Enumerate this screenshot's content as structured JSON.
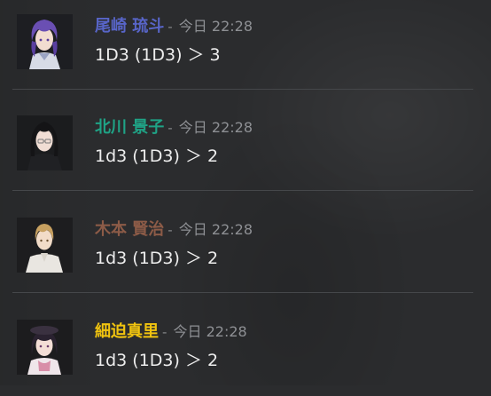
{
  "messages": [
    {
      "name": "尾崎 琉斗",
      "name_color": "#5865c8",
      "separator": "-",
      "timestamp": "今日 22:28",
      "content": "1D3 (1D3) ＞ 3",
      "avatar": "avatar-purple-hair-character"
    },
    {
      "name": "北川 景子",
      "name_color": "#1fa386",
      "separator": "-",
      "timestamp": "今日 22:28",
      "content": "1d3 (1D3) ＞ 2",
      "avatar": "avatar-black-hair-glasses-character"
    },
    {
      "name": "木本 賢治",
      "name_color": "#8c5b47",
      "separator": "-",
      "timestamp": "今日 22:28",
      "content": "1d3 (1D3) ＞ 2",
      "avatar": "avatar-blond-hair-character"
    },
    {
      "name": "細迫真里",
      "name_color": "#f1c40f",
      "separator": "-",
      "timestamp": "今日 22:28",
      "content": "1d3 (1D3) ＞ 2",
      "avatar": "avatar-dark-hair-hat-character"
    }
  ]
}
